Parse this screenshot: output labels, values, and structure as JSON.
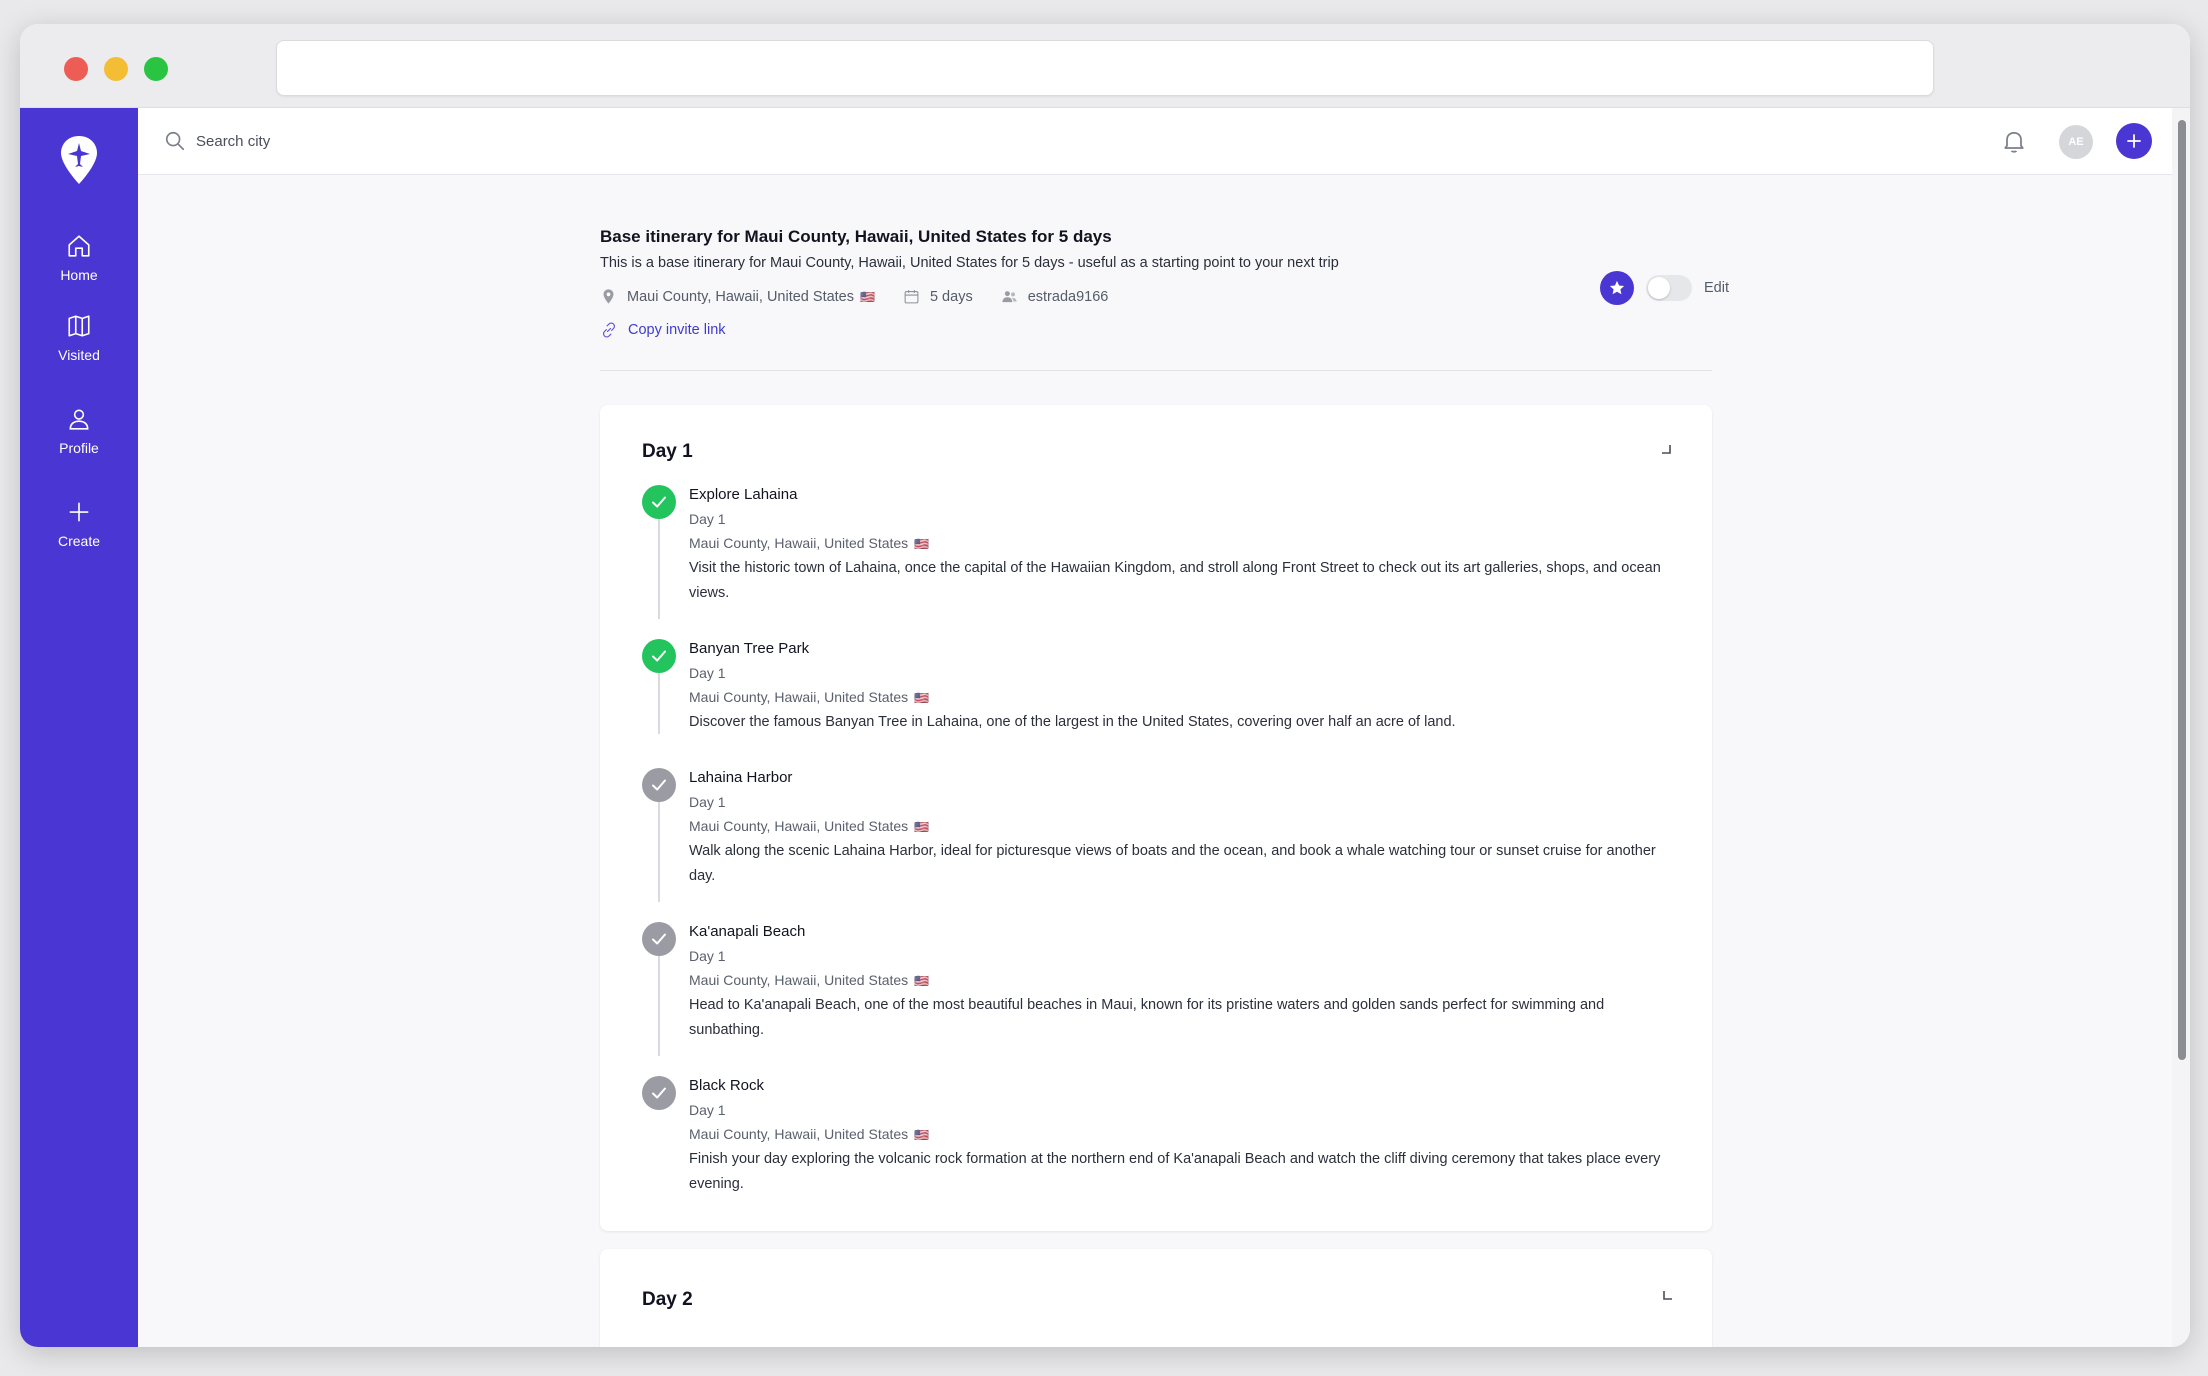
{
  "search": {
    "placeholder": "Search city"
  },
  "sidebar": {
    "items": [
      {
        "label": "Home",
        "icon": "home-icon"
      },
      {
        "label": "Visited",
        "icon": "map-icon"
      },
      {
        "label": "Profile",
        "icon": "user-icon"
      },
      {
        "label": "Create",
        "icon": "plus-icon"
      }
    ]
  },
  "header": {
    "avatar_initials": "AE"
  },
  "trip": {
    "title": "Base itinerary for Maui County, Hawaii, United States for 5 days",
    "description": "This is a base itinerary for Maui County, Hawaii, United States for 5 days - useful as a starting point to your next trip",
    "location": "Maui County, Hawaii, United States",
    "flag": "🇺🇸",
    "duration": "5 days",
    "owner": "estrada9166",
    "invite_label": "Copy invite link",
    "edit_label": "Edit"
  },
  "days": [
    {
      "title": "Day 1",
      "activities": [
        {
          "title": "Explore Lahaina",
          "day": "Day 1",
          "location": "Maui County, Hawaii, United States",
          "flag": "🇺🇸",
          "description": "Visit the historic town of Lahaina, once the capital of the Hawaiian Kingdom, and stroll along Front Street to check out its art galleries, shops, and ocean views.",
          "status": "done"
        },
        {
          "title": "Banyan Tree Park",
          "day": "Day 1",
          "location": "Maui County, Hawaii, United States",
          "flag": "🇺🇸",
          "description": "Discover the famous Banyan Tree in Lahaina, one of the largest in the United States, covering over half an acre of land.",
          "status": "done"
        },
        {
          "title": "Lahaina Harbor",
          "day": "Day 1",
          "location": "Maui County, Hawaii, United States",
          "flag": "🇺🇸",
          "description": "Walk along the scenic Lahaina Harbor, ideal for picturesque views of boats and the ocean, and book a whale watching tour or sunset cruise for another day.",
          "status": "pending"
        },
        {
          "title": "Ka'anapali Beach",
          "day": "Day 1",
          "location": "Maui County, Hawaii, United States",
          "flag": "🇺🇸",
          "description": "Head to Ka'anapali Beach, one of the most beautiful beaches in Maui, known for its pristine waters and golden sands perfect for swimming and sunbathing.",
          "status": "pending"
        },
        {
          "title": "Black Rock",
          "day": "Day 1",
          "location": "Maui County, Hawaii, United States",
          "flag": "🇺🇸",
          "description": "Finish your day exploring the volcanic rock formation at the northern end of Ka'anapali Beach and watch the cliff diving ceremony that takes place every evening.",
          "status": "pending"
        }
      ]
    },
    {
      "title": "Day 2",
      "activities": []
    }
  ],
  "colors": {
    "brand": "#4a36d2",
    "done": "#23c45e",
    "pending": "#9b9ca3"
  }
}
